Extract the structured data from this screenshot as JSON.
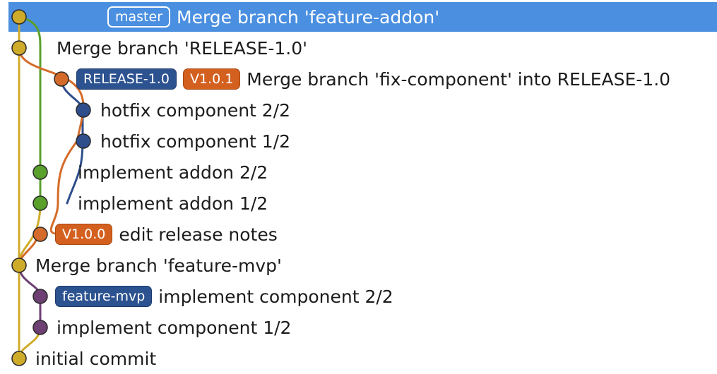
{
  "lane_colors": {
    "master": "#cfab2a",
    "addon": "#5aa02c",
    "release": "#d56b2a",
    "fix": "#2f4f8c",
    "mvp": "#6d3f73"
  },
  "selection_color": "#4a8fe0",
  "commits": [
    {
      "message": "Merge branch 'feature-addon'",
      "refs": [
        {
          "label": "master",
          "type": "current"
        }
      ]
    },
    {
      "message": "Merge branch 'RELEASE-1.0'",
      "refs": []
    },
    {
      "message": "Merge branch 'fix-component' into RELEASE-1.0",
      "refs": [
        {
          "label": "RELEASE-1.0",
          "type": "local"
        },
        {
          "label": "V1.0.1",
          "type": "tag"
        }
      ]
    },
    {
      "message": "hotfix component 2/2",
      "refs": []
    },
    {
      "message": "hotfix component 1/2",
      "refs": []
    },
    {
      "message": "implement addon 2/2",
      "refs": []
    },
    {
      "message": "implement addon 1/2",
      "refs": []
    },
    {
      "message": "edit release notes",
      "refs": [
        {
          "label": "V1.0.0",
          "type": "tag"
        }
      ]
    },
    {
      "message": "Merge branch 'feature-mvp'",
      "refs": []
    },
    {
      "message": "implement component 2/2",
      "refs": [
        {
          "label": "feature-mvp",
          "type": "local"
        }
      ]
    },
    {
      "message": "implement component 1/2",
      "refs": []
    },
    {
      "message": "initial commit",
      "refs": []
    }
  ]
}
